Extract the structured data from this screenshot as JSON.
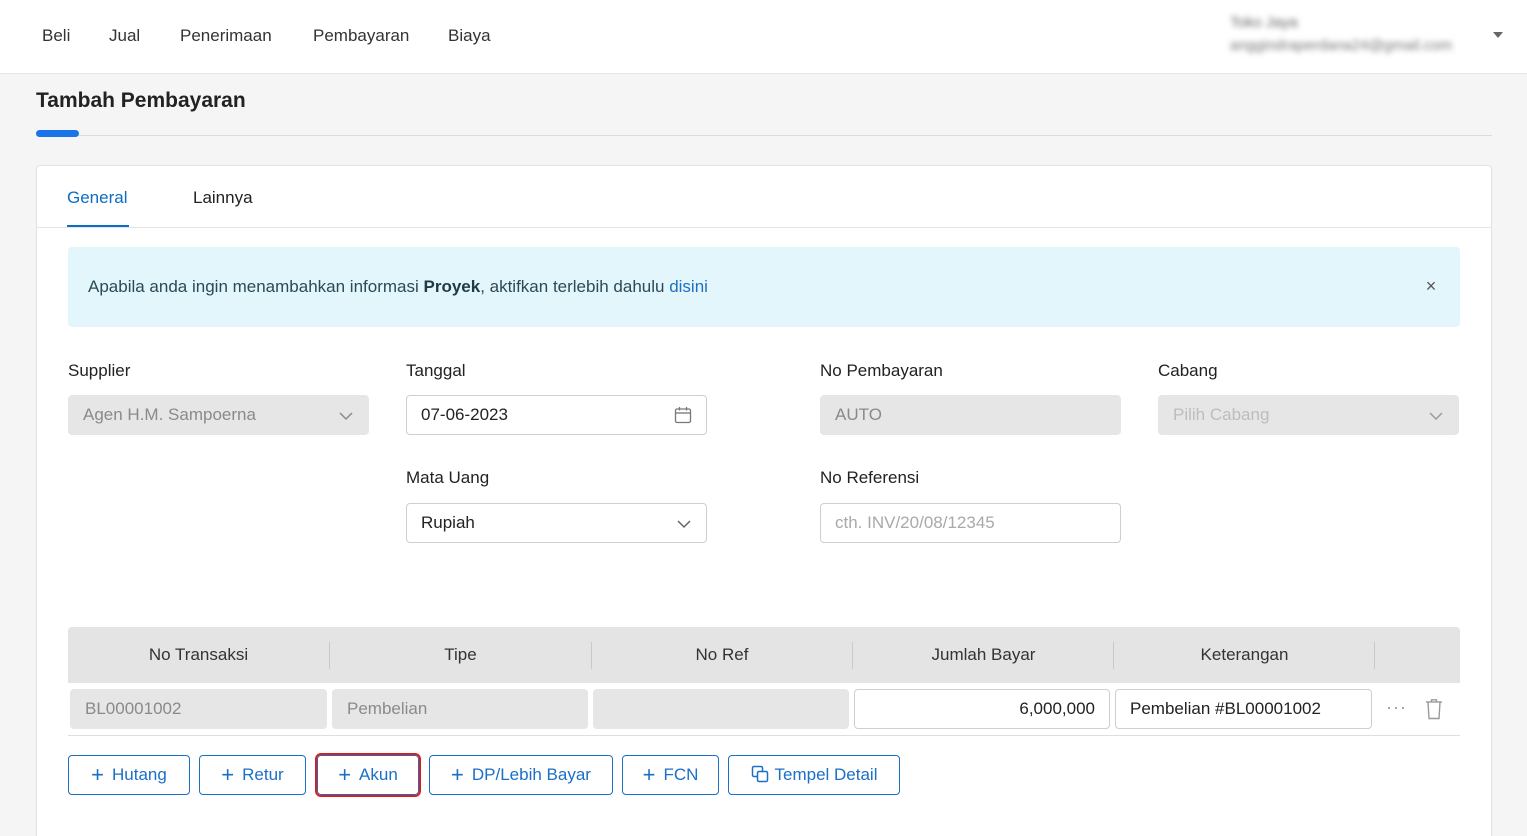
{
  "nav": {
    "items": [
      "Beli",
      "Jual",
      "Penerimaan",
      "Pembayaran",
      "Biaya"
    ],
    "user_name": "Toko Jaya",
    "user_email": "anggindraperdana24@gmail.com"
  },
  "page": {
    "title": "Tambah Pembayaran"
  },
  "tabs": [
    "General",
    "Lainnya"
  ],
  "alert": {
    "text_before": "Apabila anda ingin menambahkan informasi ",
    "bold": "Proyek",
    "text_after": ", aktifkan terlebih dahulu ",
    "link": "disini",
    "close": "×"
  },
  "form": {
    "supplier": {
      "label": "Supplier",
      "value": "Agen H.M. Sampoerna"
    },
    "tanggal": {
      "label": "Tanggal",
      "value": "07-06-2023"
    },
    "no_pembayaran": {
      "label": "No Pembayaran",
      "value": "AUTO"
    },
    "cabang": {
      "label": "Cabang",
      "placeholder": "Pilih Cabang"
    },
    "mata_uang": {
      "label": "Mata Uang",
      "value": "Rupiah"
    },
    "no_referensi": {
      "label": "No Referensi",
      "placeholder": "cth. INV/20/08/12345"
    }
  },
  "table": {
    "headers": [
      "No Transaksi",
      "Tipe",
      "No Ref",
      "Jumlah Bayar",
      "Keterangan"
    ],
    "rows": [
      {
        "no_transaksi": "BL00001002",
        "tipe": "Pembelian",
        "no_ref": "",
        "jumlah_bayar": "6,000,000",
        "keterangan": "Pembelian #BL00001002"
      }
    ]
  },
  "buttons": {
    "hutang": "Hutang",
    "retur": "Retur",
    "akun": "Akun",
    "dp": "DP/Lebih Bayar",
    "fcn": "FCN",
    "tempel": "Tempel Detail"
  },
  "colors": {
    "primary": "#1a6fc7",
    "tab_active": "#0b6dc4",
    "alert_bg": "#e3f6fc",
    "highlight": "#e11b1b"
  }
}
